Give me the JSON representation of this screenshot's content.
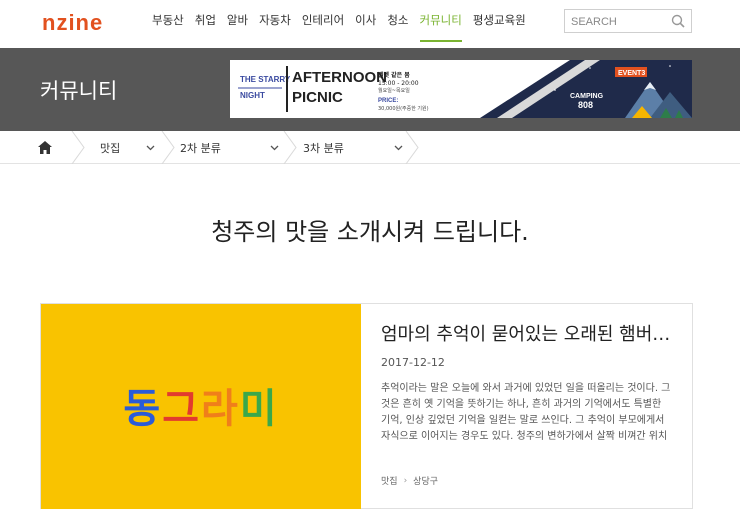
{
  "header": {
    "logo": "nzine",
    "nav": [
      "부동산",
      "취업",
      "알바",
      "자동차",
      "인테리어",
      "이사",
      "청소",
      "커뮤니티",
      "평생교육원"
    ],
    "active_nav_index": 7,
    "search_placeholder": "SEARCH"
  },
  "band": {
    "title": "커뮤니티",
    "banner": {
      "line1a": "THE STARRY",
      "line1b": "NIGHT",
      "afternoon": "AFTERNOON",
      "picnic": "PICNIC",
      "time_label": "벨벳 같은 봄",
      "time": "15:00 - 20:00",
      "days": "월요일~목요일",
      "price_label": "PRICE:",
      "price": "30,000원(주중한 기원)",
      "event": "EVENT3",
      "camping": "CAMPING",
      "camping_num": "808"
    }
  },
  "breadcrumb": {
    "level1": "맛집",
    "level2": "2차 분류",
    "level3": "3차 분류"
  },
  "heading": "청주의 맛을 소개시켜 드립니다.",
  "card": {
    "thumb_chars": [
      "동",
      "그",
      "라",
      "미"
    ],
    "thumb_colors": [
      "#2a5bd7",
      "#e23b2e",
      "#f07f1a",
      "#3aa84a"
    ],
    "title": "엄마의 추억이 묻어있는 오래된 햄버거집",
    "date": "2017-12-12",
    "description": "추억이라는 말은 오늘에 와서 과거에 있었던 일을 떠올리는 것이다. 그것은 흔히 옛 기억을 뜻하기는 하나, 흔히 과거의 기억에서도 특별한 기억, 인상 깊었던 기억을 일컫는 말로 쓰인다. 그 추억이 부모에게서 자식으로 이어지는 경우도 있다. 청주의 변하가에서 살짝 비껴간 위치에...",
    "tag1": "맛집",
    "tag2": "상당구"
  },
  "colors": {
    "brand": "#e2511f",
    "active_nav": "#7ab331",
    "band_bg": "#575757",
    "thumb_bg": "#f9c300"
  }
}
